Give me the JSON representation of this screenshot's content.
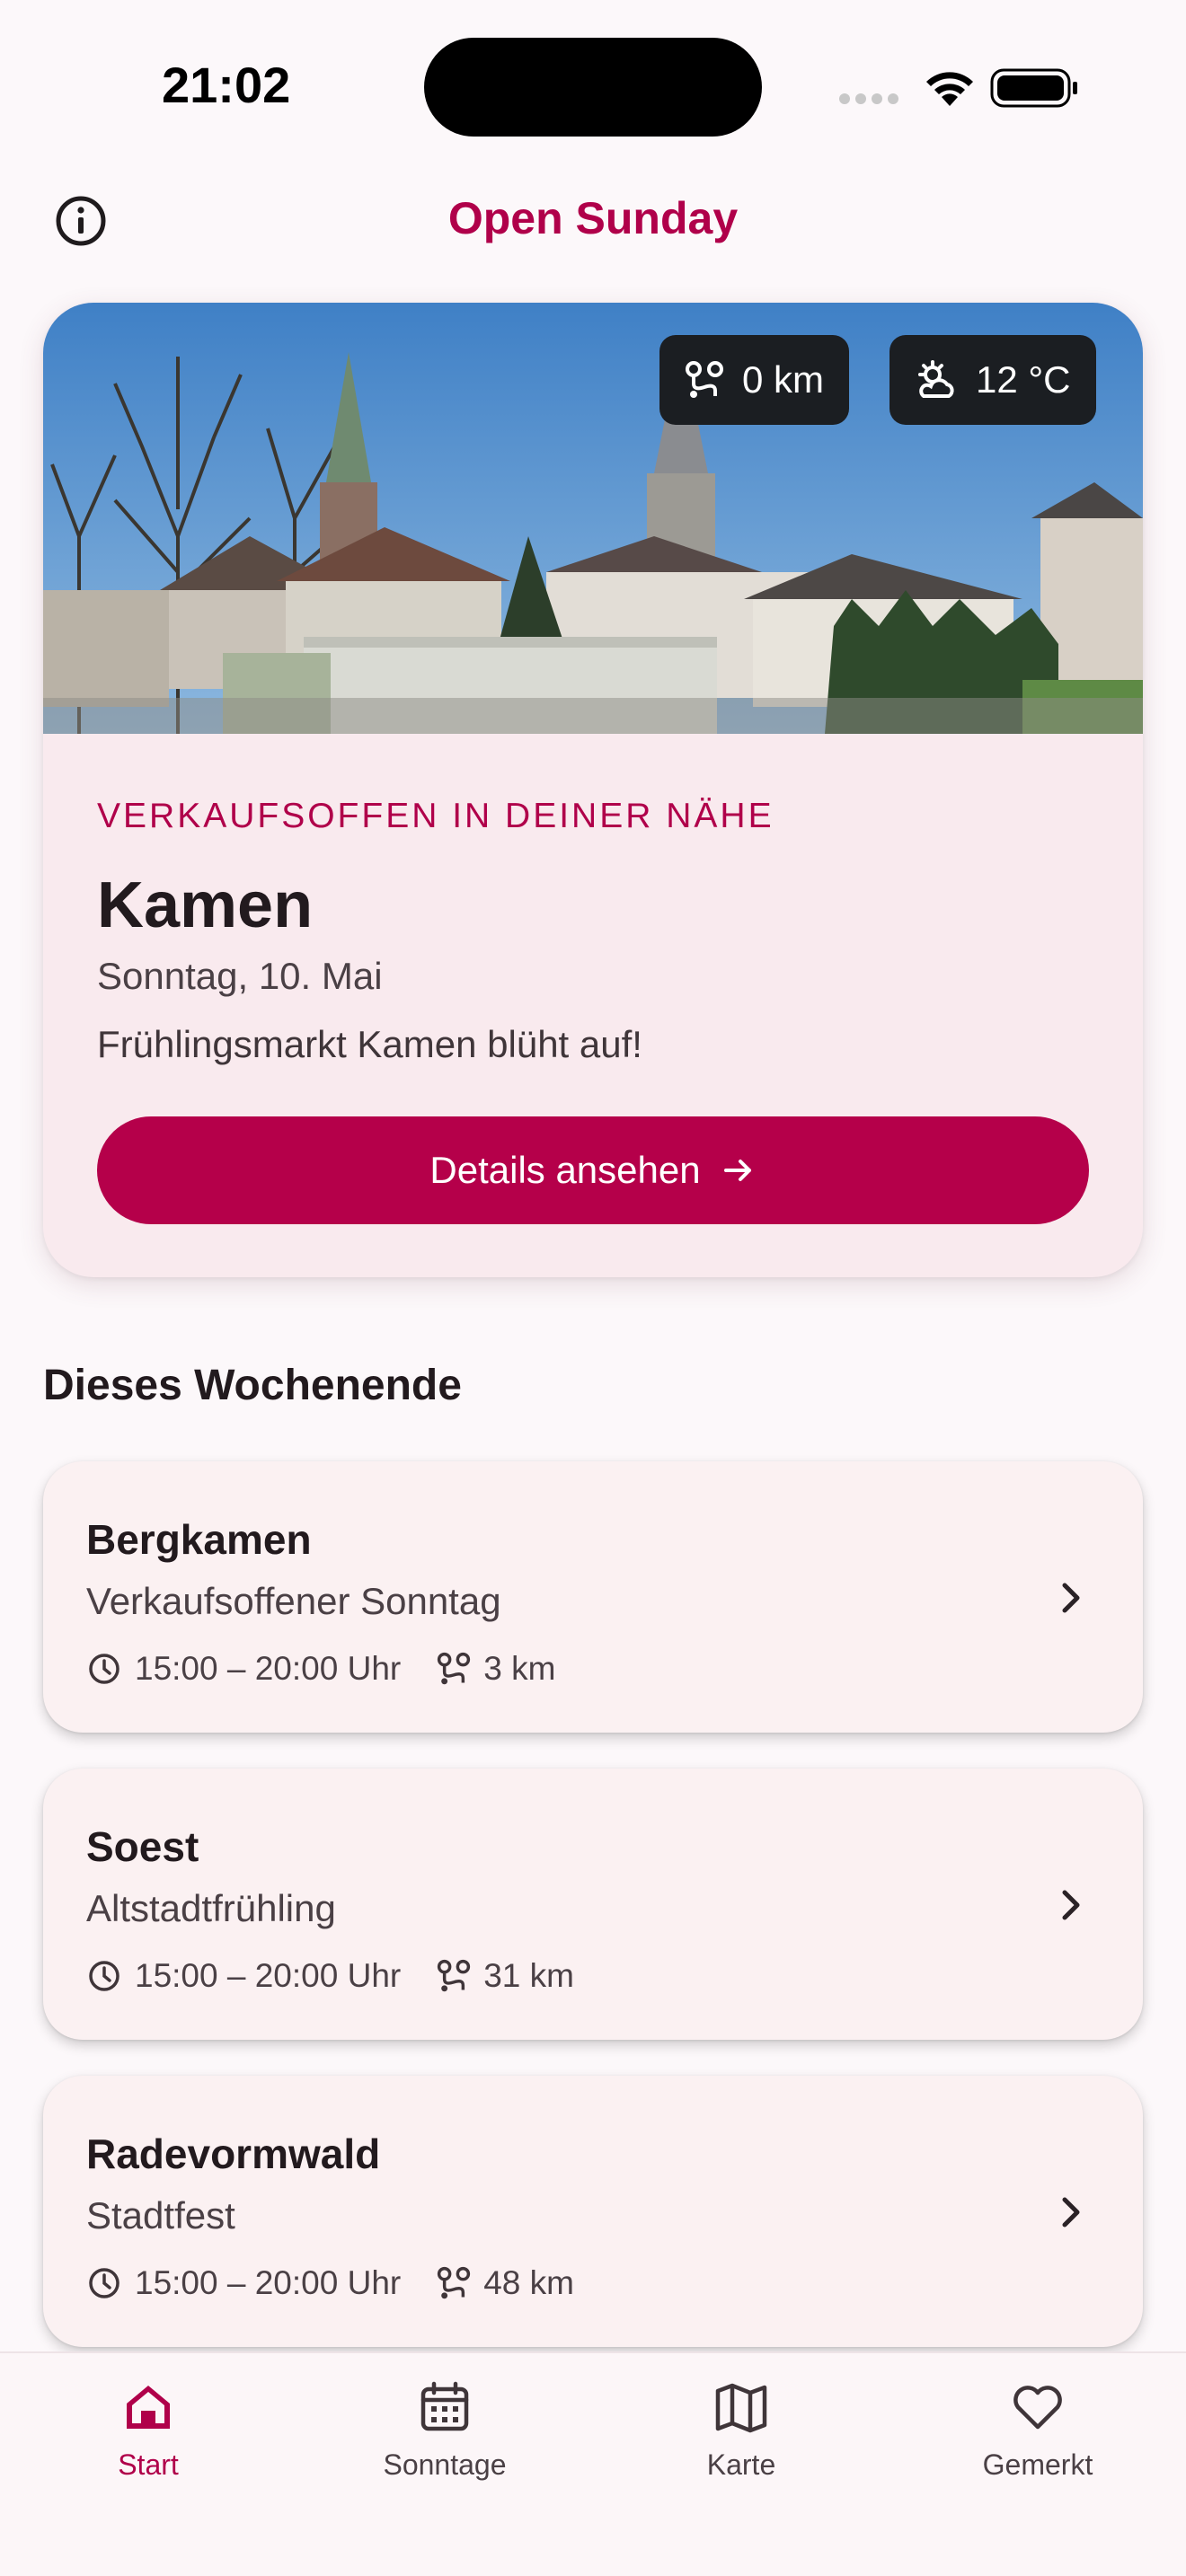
{
  "status_bar": {
    "time": "21:02"
  },
  "header": {
    "title": "Open Sunday",
    "info_icon": "info-circle-icon"
  },
  "hero": {
    "distance": "0 km",
    "weather": "12 °C",
    "eyebrow": "VERKAUFSOFFEN IN DEINER NÄHE",
    "city": "Kamen",
    "date": "Sonntag, 10. Mai",
    "description": "Frühlingsmarkt Kamen blüht auf!",
    "button_label": "Details ansehen"
  },
  "section": {
    "title": "Dieses Wochenende"
  },
  "events": [
    {
      "city": "Bergkamen",
      "name": "Verkaufsoffener Sonntag",
      "time": "15:00 – 20:00 Uhr",
      "distance": "3 km"
    },
    {
      "city": "Soest",
      "name": "Altstadtfrühling",
      "time": "15:00 – 20:00 Uhr",
      "distance": "31 km"
    },
    {
      "city": "Radevormwald",
      "name": "Stadtfest",
      "time": "15:00 – 20:00 Uhr",
      "distance": "48 km"
    }
  ],
  "nav": {
    "items": [
      {
        "label": "Start",
        "icon": "home-icon",
        "active": true
      },
      {
        "label": "Sonntage",
        "icon": "calendar-icon",
        "active": false
      },
      {
        "label": "Karte",
        "icon": "map-icon",
        "active": false
      },
      {
        "label": "Gemerkt",
        "icon": "heart-icon",
        "active": false
      }
    ]
  },
  "colors": {
    "accent": "#b0004a",
    "card_bg": "#f9eaee",
    "chip_bg": "#1b1e22"
  }
}
